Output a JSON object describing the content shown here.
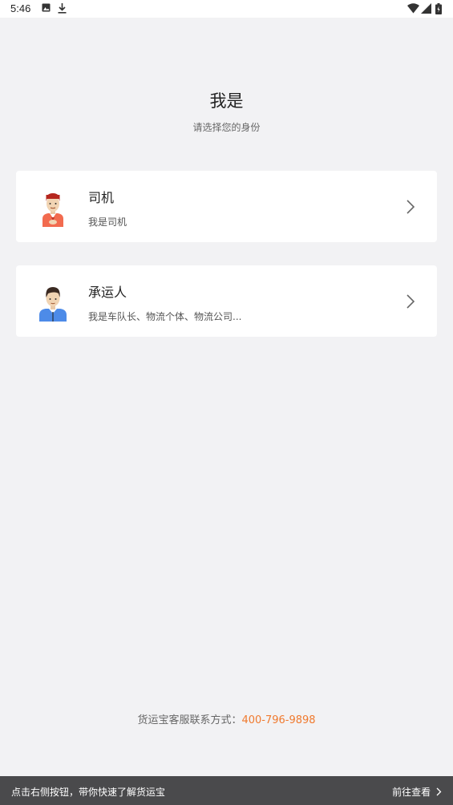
{
  "status_bar": {
    "time": "5:46",
    "icons": [
      "image-icon",
      "download-icon",
      "wifi-icon",
      "signal-icon",
      "battery-icon"
    ]
  },
  "header": {
    "title": "我是",
    "subtitle": "请选择您的身份"
  },
  "options": [
    {
      "title": "司机",
      "description": "我是司机",
      "icon": "driver-avatar-icon"
    },
    {
      "title": "承运人",
      "description": "我是车队长、物流个体、物流公司...",
      "icon": "carrier-avatar-icon"
    }
  ],
  "contact": {
    "label": "货运宝客服联系方式：",
    "phone": "400-796-9898"
  },
  "bottom_banner": {
    "text": "点击右侧按钮，带你快速了解货运宝",
    "link_label": "前往查看"
  },
  "colors": {
    "accent": "#f07a2e",
    "background": "#f2f2f4",
    "banner": "#4a4a4c"
  }
}
